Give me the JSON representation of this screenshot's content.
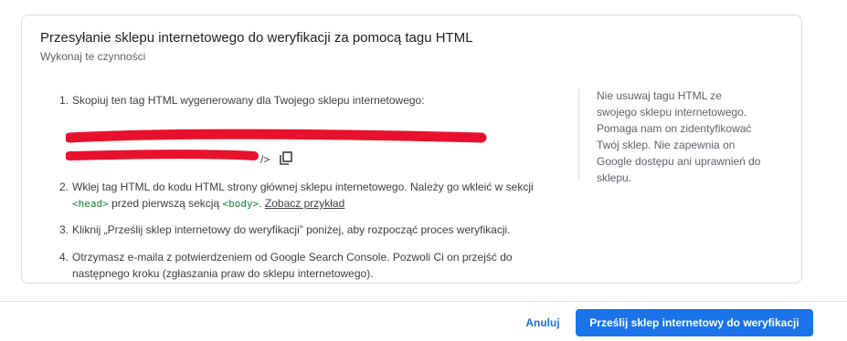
{
  "card": {
    "title": "Przesyłanie sklepu internetowego do weryfikacji za pomocą tagu HTML",
    "subtitle": "Wykonaj te czynności"
  },
  "steps": {
    "s1": {
      "num": "1.",
      "text": "Skopiuj ten tag HTML wygenerowany dla Twojego sklepu internetowego:",
      "tag_close": "/>",
      "redaction_color": "#e8112d"
    },
    "s2": {
      "num": "2.",
      "text_a": "Wklej tag HTML do kodu HTML strony głównej sklepu internetowego. Należy go wkleić w sekcji ",
      "head_tag": "<head>",
      "text_b": " przed pierwszą sekcją ",
      "body_tag": "<body>",
      "text_c": ". ",
      "link": "Zobacz przykład"
    },
    "s3": {
      "num": "3.",
      "text": "Kliknij „Prześlij sklep internetowy do weryfikacji” poniżej, aby rozpocząć proces weryfikacji."
    },
    "s4": {
      "num": "4.",
      "text": "Otrzymasz e-maila z potwierdzeniem od Google Search Console. Pozwoli Ci on przejść do następnego kroku (zgłaszania praw do sklepu internetowego)."
    }
  },
  "side_note": "Nie usuwaj tagu HTML ze swojego sklepu internetowego. Pomaga nam on zidentyfikować Twój sklep. Nie zapewnia on Google dostępu ani uprawnień do sklepu.",
  "footer": {
    "cancel_label": "Anuluj",
    "submit_label": "Prześlij sklep internetowy do weryfikacji"
  },
  "colors": {
    "primary": "#1a73e8",
    "code_green": "#188038"
  }
}
